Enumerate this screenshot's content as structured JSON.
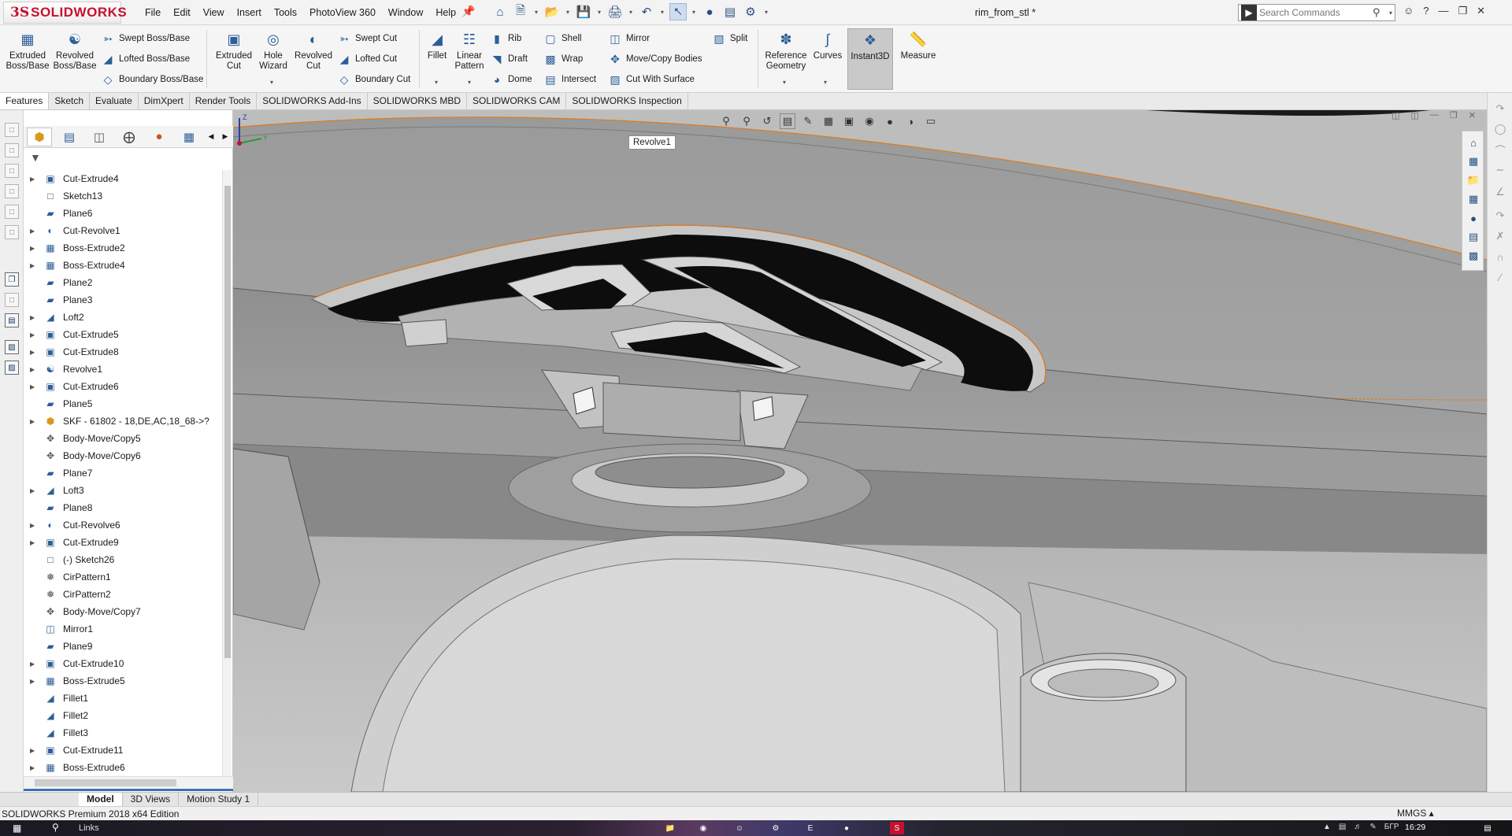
{
  "app": {
    "logo_prefix": "3S",
    "logo_name": "SOLIDWORKS",
    "document_title": "rim_from_stl *",
    "search_placeholder": "Search Commands"
  },
  "menu": [
    "File",
    "Edit",
    "View",
    "Insert",
    "Tools",
    "PhotoView 360",
    "Window",
    "Help"
  ],
  "ribbon": {
    "extruded_boss": "Extruded Boss/Base",
    "revolved_boss": "Revolved Boss/Base",
    "swept_boss": "Swept Boss/Base",
    "lofted_boss": "Lofted Boss/Base",
    "boundary_boss": "Boundary Boss/Base",
    "extruded_cut": "Extruded Cut",
    "hole_wizard": "Hole Wizard",
    "revolved_cut": "Revolved Cut",
    "swept_cut": "Swept Cut",
    "lofted_cut": "Lofted Cut",
    "boundary_cut": "Boundary Cut",
    "fillet": "Fillet",
    "linear_pattern": "Linear Pattern",
    "rib": "Rib",
    "draft": "Draft",
    "dome": "Dome",
    "shell": "Shell",
    "wrap": "Wrap",
    "intersect": "Intersect",
    "mirror": "Mirror",
    "move_copy": "Move/Copy Bodies",
    "cut_with_surface": "Cut With Surface",
    "split": "Split",
    "reference_geometry": "Reference Geometry",
    "curves": "Curves",
    "instant3d": "Instant3D",
    "measure": "Measure"
  },
  "command_tabs": [
    "Features",
    "Sketch",
    "Evaluate",
    "DimXpert",
    "Render Tools",
    "SOLIDWORKS Add-Ins",
    "SOLIDWORKS MBD",
    "SOLIDWORKS CAM",
    "SOLIDWORKS Inspection"
  ],
  "active_command_tab": "Features",
  "tree": [
    {
      "label": "Cut-Extrude4",
      "icon": "cut-extrude-icon",
      "expandable": true
    },
    {
      "label": "Sketch13",
      "icon": "sketch-icon",
      "expandable": false
    },
    {
      "label": "Plane6",
      "icon": "plane-icon",
      "expandable": false
    },
    {
      "label": "Cut-Revolve1",
      "icon": "cut-revolve-icon",
      "expandable": true
    },
    {
      "label": "Boss-Extrude2",
      "icon": "boss-extrude-icon",
      "expandable": true
    },
    {
      "label": "Boss-Extrude4",
      "icon": "boss-extrude-icon",
      "expandable": true
    },
    {
      "label": "Plane2",
      "icon": "plane-icon",
      "expandable": false
    },
    {
      "label": "Plane3",
      "icon": "plane-icon",
      "expandable": false
    },
    {
      "label": "Loft2",
      "icon": "loft-icon",
      "expandable": true
    },
    {
      "label": "Cut-Extrude5",
      "icon": "cut-extrude-icon",
      "expandable": true
    },
    {
      "label": "Cut-Extrude8",
      "icon": "cut-extrude-icon",
      "expandable": true
    },
    {
      "label": "Revolve1",
      "icon": "revolve-icon",
      "expandable": true
    },
    {
      "label": "Cut-Extrude6",
      "icon": "cut-extrude-icon",
      "expandable": true
    },
    {
      "label": "Plane5",
      "icon": "plane-icon",
      "expandable": false
    },
    {
      "label": "SKF - 61802 - 18,DE,AC,18_68->?",
      "icon": "bearing-part-icon",
      "expandable": true
    },
    {
      "label": "Body-Move/Copy5",
      "icon": "move-copy-icon",
      "expandable": false
    },
    {
      "label": "Body-Move/Copy6",
      "icon": "move-copy-icon",
      "expandable": false
    },
    {
      "label": "Plane7",
      "icon": "plane-icon",
      "expandable": false
    },
    {
      "label": "Loft3",
      "icon": "loft-icon",
      "expandable": true
    },
    {
      "label": "Plane8",
      "icon": "plane-icon",
      "expandable": false
    },
    {
      "label": "Cut-Revolve6",
      "icon": "cut-revolve-icon",
      "expandable": true
    },
    {
      "label": "Cut-Extrude9",
      "icon": "cut-extrude-icon",
      "expandable": true
    },
    {
      "label": "(-) Sketch26",
      "icon": "sketch-icon",
      "expandable": false
    },
    {
      "label": "CirPattern1",
      "icon": "circular-pattern-icon",
      "expandable": false
    },
    {
      "label": "CirPattern2",
      "icon": "circular-pattern-icon",
      "expandable": false
    },
    {
      "label": "Body-Move/Copy7",
      "icon": "move-copy-icon",
      "expandable": false
    },
    {
      "label": "Mirror1",
      "icon": "mirror-icon",
      "expandable": false
    },
    {
      "label": "Plane9",
      "icon": "plane-icon",
      "expandable": false
    },
    {
      "label": "Cut-Extrude10",
      "icon": "cut-extrude-icon",
      "expandable": true
    },
    {
      "label": "Boss-Extrude5",
      "icon": "boss-extrude-icon",
      "expandable": true
    },
    {
      "label": "Fillet1",
      "icon": "fillet-icon",
      "expandable": false
    },
    {
      "label": "Fillet2",
      "icon": "fillet-icon",
      "expandable": false
    },
    {
      "label": "Fillet3",
      "icon": "fillet-icon",
      "expandable": false
    },
    {
      "label": "Cut-Extrude11",
      "icon": "cut-extrude-icon",
      "expandable": true
    },
    {
      "label": "Boss-Extrude6",
      "icon": "boss-extrude-icon",
      "expandable": true
    }
  ],
  "viewport": {
    "tooltip": "Revolve1",
    "triad_labels": {
      "z": "Z",
      "y": "Y"
    }
  },
  "bottom_tabs": [
    "Model",
    "3D Views",
    "Motion Study 1"
  ],
  "active_bottom_tab": "Model",
  "status": {
    "edition": "SOLIDWORKS Premium 2018 x64 Edition",
    "units": "MMGS"
  },
  "taskbar": {
    "links": "Links",
    "clock": "16:29",
    "lang": "БГР"
  },
  "colors": {
    "brand_red": "#c8102e",
    "accent_blue": "#2d5e98",
    "model_grey": "#a8a8a8",
    "edge_orange": "#e07a20"
  }
}
